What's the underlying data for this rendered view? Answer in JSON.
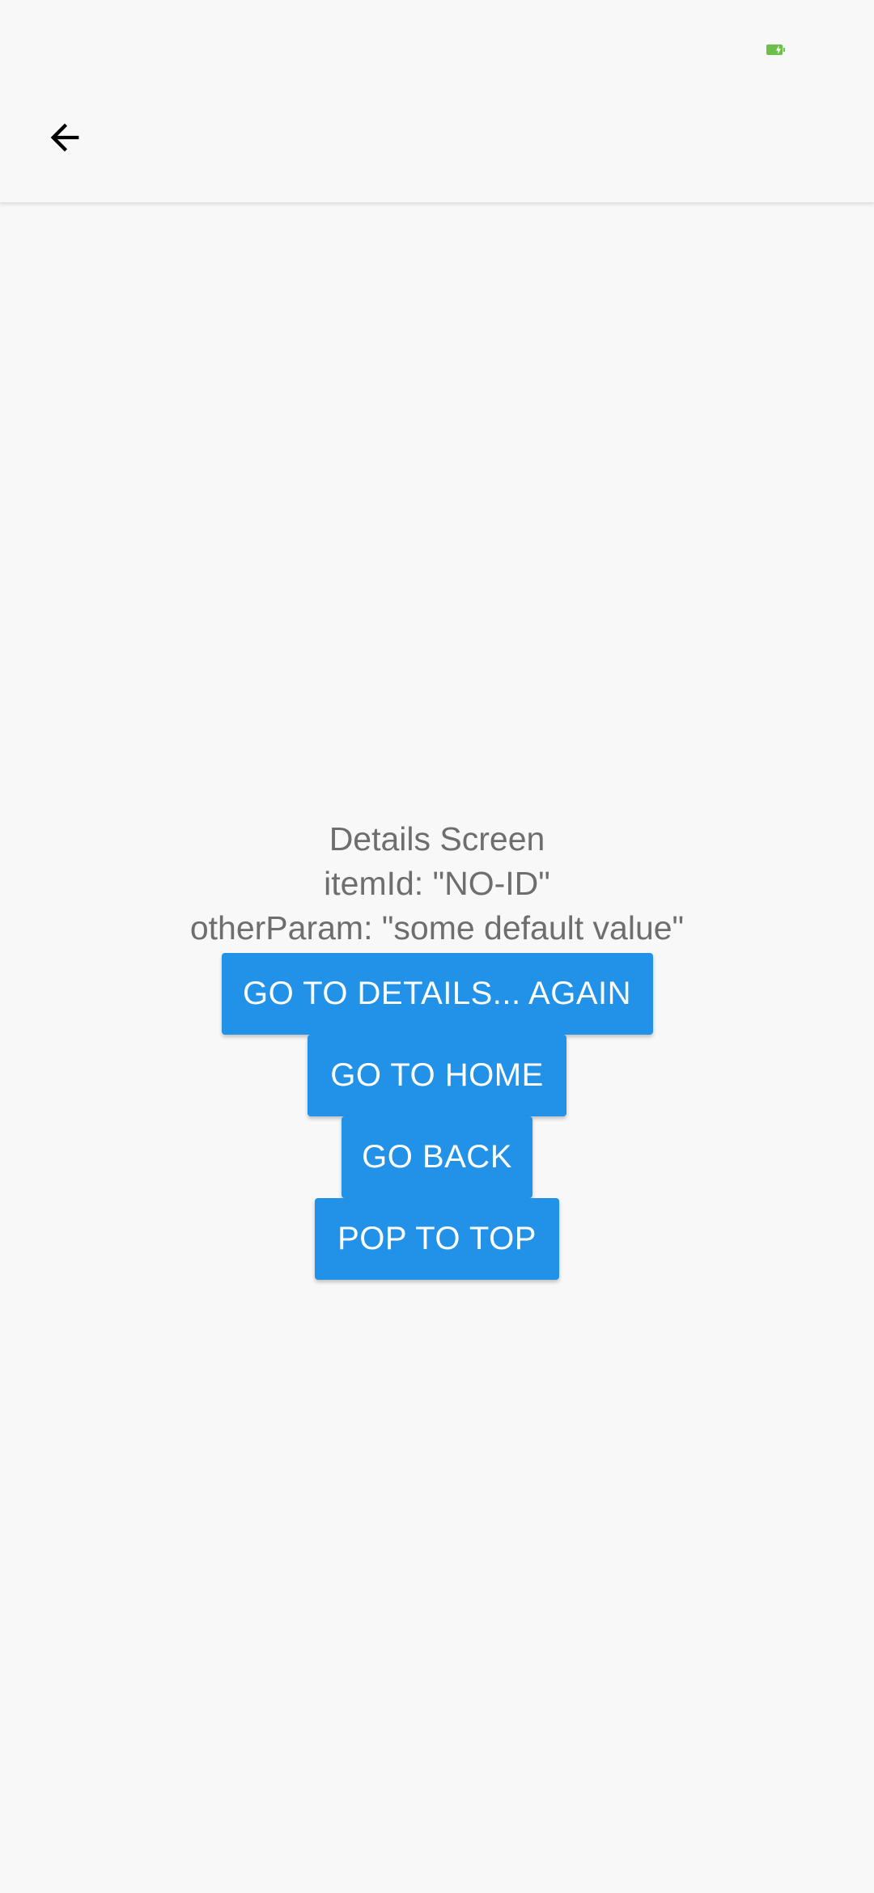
{
  "status_bar": {
    "battery_color": "#6cc04a"
  },
  "header": {
    "back_icon": "arrow-left-icon"
  },
  "details": {
    "title": "Details Screen",
    "item_id_line": "itemId: \"NO-ID\"",
    "other_param_line": "otherParam: \"some default value\""
  },
  "buttons": {
    "go_to_details_again": "GO TO DETAILS... AGAIN",
    "go_to_home": "GO TO HOME",
    "go_back": "GO BACK",
    "pop_to_top": "POP TO TOP"
  },
  "colors": {
    "button_background": "#2292e8",
    "button_text": "#ffffff",
    "body_text": "#6e6e6e",
    "background": "#f8f8f9"
  }
}
